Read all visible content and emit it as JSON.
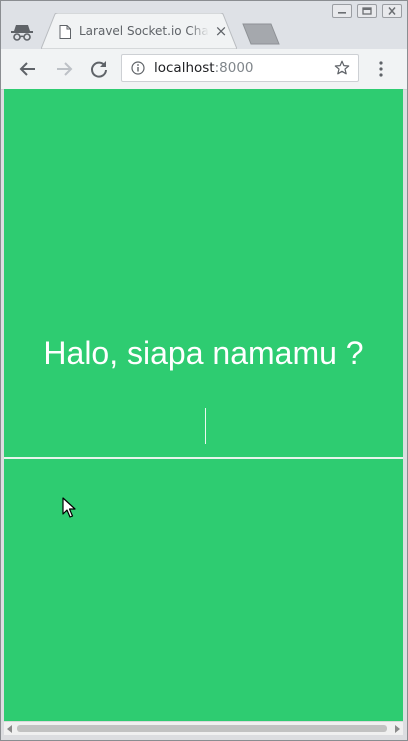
{
  "browser": {
    "tab_title": "Laravel Socket.io Chat",
    "tab_close": "×",
    "address": {
      "host": "localhost",
      "port": ":8000"
    }
  },
  "page": {
    "heading": "Halo, siapa namamu ?",
    "name_input_value": ""
  },
  "colors": {
    "page_background": "#2ecc71",
    "heading_text": "#ffffff"
  },
  "icons": {
    "incognito": "incognito-icon",
    "tab_favicon": "document-icon",
    "back": "back-arrow-icon",
    "forward": "forward-arrow-icon",
    "reload": "reload-icon",
    "site_info": "info-icon",
    "bookmark": "star-icon",
    "menu": "vertical-dots-icon"
  }
}
